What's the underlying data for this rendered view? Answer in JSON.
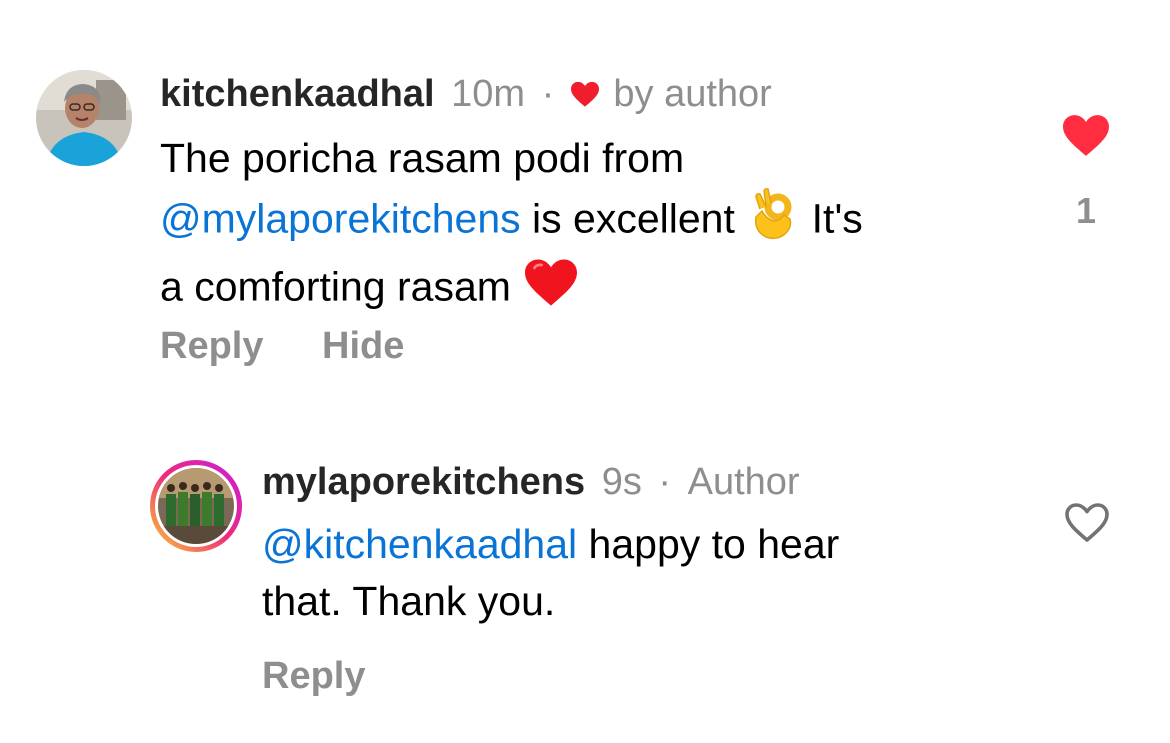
{
  "comments": [
    {
      "username": "kitchenkaadhal",
      "time": "10m",
      "separator": "·",
      "liked_by_author_label": "by author",
      "text_part1": "The poricha rasam podi from",
      "mention": "@mylaporekitchens",
      "text_part2": " is excellent ",
      "text_part3": " It's",
      "text_part4": "a comforting rasam ",
      "reply_label": "Reply",
      "hide_label": "Hide",
      "like_count": "1",
      "liked": true
    },
    {
      "username": "mylaporekitchens",
      "time": "9s",
      "separator": "·",
      "author_label": "Author",
      "mention": "@kitchenkaadhal",
      "text_part1": " happy to hear",
      "text_part2": "that. Thank you.",
      "reply_label": "Reply",
      "liked": false
    }
  ],
  "colors": {
    "like_red": "#ff2d55",
    "mention_blue": "#0a74d6",
    "meta_gray": "#8e8e8e",
    "story_ring_start": "#f9ce34",
    "story_ring_mid": "#ee2a7b",
    "story_ring_end": "#6228d7"
  },
  "icons": {
    "like_filled": "heart-filled-icon",
    "like_outline": "heart-outline-icon",
    "ok_hand": "ok-hand-emoji",
    "red_heart": "red-heart-emoji"
  }
}
